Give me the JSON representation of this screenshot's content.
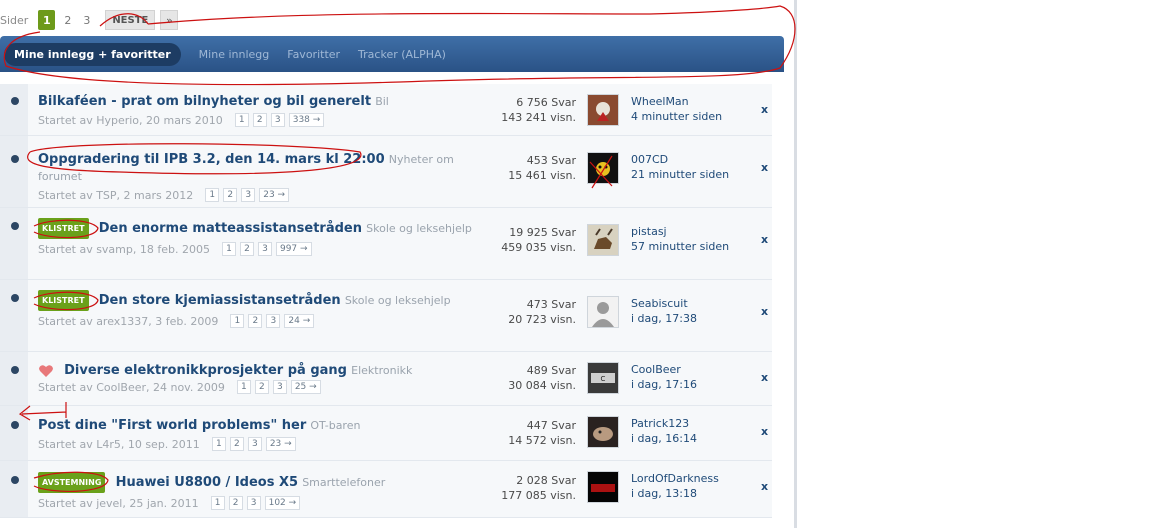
{
  "pagination": {
    "label": "Sider",
    "pages": [
      "1",
      "2",
      "3"
    ],
    "active": "1",
    "next": "NESTE",
    "last": "»"
  },
  "tabs": [
    {
      "label": "Mine innlegg + favoritter",
      "active": true
    },
    {
      "label": "Mine innlegg",
      "active": false
    },
    {
      "label": "Favoritter",
      "active": false
    },
    {
      "label": "Tracker (ALPHA)",
      "active": false
    }
  ],
  "topics": [
    {
      "tag": "",
      "title": "Bilkaféen - prat om bilnyheter og bil generelt",
      "forum": "Bil",
      "started": "Startet av Hyperio, 20 mars 2010",
      "pages": [
        "1",
        "2",
        "3",
        "338 →"
      ],
      "replies": "6 756 Svar",
      "views": "143 241 visn.",
      "last_user": "WheelMan",
      "last_time": "4 minutter siden",
      "close": "x"
    },
    {
      "tag": "",
      "title": "Oppgradering til IPB 3.2, den 14. mars kl 22:00",
      "forum": "Nyheter om forumet",
      "started": "Startet av TSP, 2 mars 2012",
      "pages": [
        "1",
        "2",
        "3",
        "23 →"
      ],
      "replies": "453 Svar",
      "views": "15 461 visn.",
      "last_user": "007CD",
      "last_time": "21 minutter siden",
      "close": "x"
    },
    {
      "tag": "KLISTRET",
      "title": "Den enorme matteassistansetråden",
      "forum": "Skole og leksehjelp",
      "started": "Startet av svamp, 18 feb. 2005",
      "pages": [
        "1",
        "2",
        "3",
        "997 →"
      ],
      "replies": "19 925 Svar",
      "views": "459 035 visn.",
      "last_user": "pistasj",
      "last_time": "57 minutter siden",
      "close": "x"
    },
    {
      "tag": "KLISTRET",
      "title": "Den store kjemiassistansetråden",
      "forum": "Skole og leksehjelp",
      "started": "Startet av arex1337, 3 feb. 2009",
      "pages": [
        "1",
        "2",
        "3",
        "24 →"
      ],
      "replies": "473 Svar",
      "views": "20 723 visn.",
      "last_user": "Seabiscuit",
      "last_time": "i dag, 17:38",
      "close": "x"
    },
    {
      "tag": "",
      "title": "Diverse elektronikkprosjekter på gang",
      "forum": "Elektronikk",
      "started": "Startet av CoolBeer, 24 nov. 2009",
      "pages": [
        "1",
        "2",
        "3",
        "25 →"
      ],
      "replies": "489 Svar",
      "views": "30 084 visn.",
      "last_user": "CoolBeer",
      "last_time": "i dag, 17:16",
      "close": "x"
    },
    {
      "tag": "",
      "title": "Post dine \"First world problems\" her",
      "forum": "OT-baren",
      "started": "Startet av L4r5, 10 sep. 2011",
      "pages": [
        "1",
        "2",
        "3",
        "23 →"
      ],
      "replies": "447 Svar",
      "views": "14 572 visn.",
      "last_user": "Patrick123",
      "last_time": "i dag, 16:14",
      "close": "x"
    },
    {
      "tag": "AVSTEMNING",
      "title": "Huawei U8800 / Ideos X5",
      "forum": "Smarttelefoner",
      "started": "Startet av jevel, 25 jan. 2011",
      "pages": [
        "1",
        "2",
        "3",
        "102 →"
      ],
      "replies": "2 028 Svar",
      "views": "177 085 visn.",
      "last_user": "LordOfDarkness",
      "last_time": "i dag, 13:18",
      "close": "x"
    }
  ],
  "colors": {
    "tabbar": "#2f5c92",
    "title": "#1f4a78",
    "tag": "#6aa11a",
    "annotation": "#cc1111"
  }
}
